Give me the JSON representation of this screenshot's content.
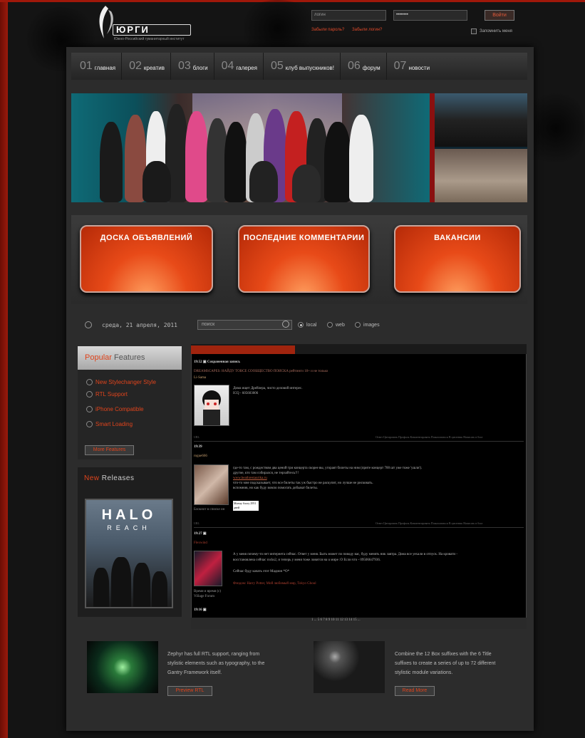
{
  "header": {
    "logo_text": "ЮРГИ",
    "logo_subtitle": "Южно-Российский гуманитарный институт",
    "login_placeholder": "логин",
    "password_value": "••••••••",
    "login_button": "Войти",
    "forgot_password": "Забыли пароль?",
    "forgot_login": "Забыли логин?",
    "remember_me": "Запомнить меня"
  },
  "nav": [
    {
      "num": "01",
      "label": "главная"
    },
    {
      "num": "02",
      "label": "креатив"
    },
    {
      "num": "03",
      "label": "блоги"
    },
    {
      "num": "04",
      "label": "галерея"
    },
    {
      "num": "05",
      "label": "клуб выпускников!"
    },
    {
      "num": "06",
      "label": "форум"
    },
    {
      "num": "07",
      "label": "новости"
    }
  ],
  "boxes": [
    "ДОСКА ОБЪЯВЛЕНИЙ",
    "ПОСЛЕДНИЕ КОММЕНТАРИИ",
    "ВАКАНСИИ"
  ],
  "toolbar": {
    "date": "среда, 21 апреля, 2011",
    "search_placeholder": "поиск",
    "radio_local": "local",
    "radio_web": "web",
    "radio_images": "images"
  },
  "popular": {
    "title_highlight": "Popular",
    "title_rest": " Features",
    "items": [
      "New Stylechanger Style",
      "RTL Support",
      "iPhone Compatible",
      "Smart Loading"
    ],
    "more_button": "More Features"
  },
  "new_releases": {
    "title_highlight": "New",
    "title_rest": " Releases",
    "game_title": "HALO",
    "game_subtitle": "REACH"
  },
  "feed": {
    "post1": {
      "time": "19:52",
      "heading": "Сохраненная запись",
      "title": "DREAMSCAPES: НАЙДУ ТОВСЕ СООБЩЕСТВО ПОИСКА рейтинги 18+ и не только",
      "author": "Li-Sama",
      "text1": "Дима ищет Дрейлера, чисто деловой интерес.",
      "text2": "ICQ - 605603006",
      "actions_left": "URL",
      "actions_right": "Ответ   Цитировать   Профиль   Комментировать   Пожаловаться   В цитатник   Написать в блог"
    },
    "post2": {
      "time": "19:39",
      "author": "rogue666",
      "text1": "где-то там, с рождеством два ценой три концерта скорее вы, угораят билеты на ним (прите концерт 700 шт уже тоже 'ушли').",
      "text2": "другие, кто там собирался, не терзайтесь!!!",
      "text3": "www.heathrestaurika.ru",
      "text4": "что-то мне подсказывает, что все билеты так уж быстро не раскупят, но лучше не рисковать.",
      "text5": "вспомнив, но как буду вовсю помогать добыват билеты.",
      "caption": "Блокнот в списке ин",
      "badge": "Моему блогу 2951 дней",
      "actions_left": "URL",
      "actions_right": "Ответ   Цитировать   Профиль   Комментировать   Пожаловаться   В цитатник   Написать в блог"
    },
    "post3": {
      "time": "19:27",
      "author": "Flexwind",
      "text1": "А у меня почему-то нет интернета сейчас. Ответ у меня. Быть может по поводу вас, буду менять ник завтра. Дома все уехали в отпуск. На кровати -",
      "text2": "восстановлена сейчас rocks2, и теперь у меня тоже ловится на u мире :O Если что - 09506647936.",
      "text3": "Сейчас буду качать этот Мадион *O*",
      "tags": "Фэндом:  Harry Potter, Мой любимый мир, Tokyo Ghoul",
      "caption": "Время и время (с) Village Forum",
      "time4": "19:16"
    },
    "pager": "1 ... 5  6  7  8  9  10  11  12  13  14  15 ..."
  },
  "bottom": {
    "text1": "Zephyr has full RTL support, ranging from stylistic elements such as typography, to the Gantry Framework itself.",
    "button1": "Preview RTL",
    "text2": "Combine the 12 Box suffixes with the 6 Title suffixes to create a series of up to 72 different stylistic module variations.",
    "button2": "Read More"
  },
  "colors": {
    "accent": "#e0441c",
    "box_orange": "#e84a18",
    "background": "#141414",
    "panel": "#2c2c2c"
  }
}
